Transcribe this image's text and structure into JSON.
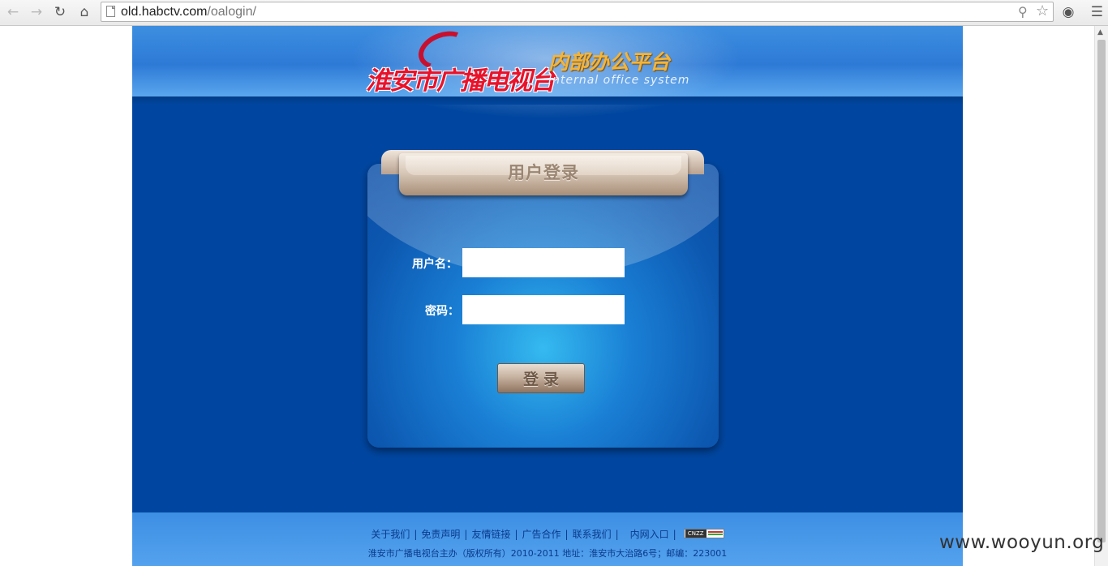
{
  "browser": {
    "url_host": "old.habctv.com",
    "url_path": "/oalogin/"
  },
  "site": {
    "logo_name": "淮安市广播电视台",
    "logo_subtitle": "内部办公平台",
    "logo_english": "Internal office system"
  },
  "login": {
    "title": "用户登录",
    "username_label": "用户名：",
    "username_value": "",
    "password_label": "密码：",
    "password_value": "",
    "submit_label": "登录"
  },
  "footer": {
    "links": [
      "关于我们",
      "免责声明",
      "友情链接",
      "广告合作",
      "联系我们",
      "内网入口"
    ],
    "badge_text": "CNZZ",
    "copyright": "淮安市广播电视台主办（版权所有）2010-2011  地址：淮安市大治路6号；邮编：223001"
  },
  "watermark": "www.wooyun.org",
  "colors": {
    "page_bg": "#0046a0",
    "banner": "#2d7ad6",
    "logo_red": "#e8132b",
    "logo_gold": "#f3b43a",
    "footer_text": "#0b3a8c"
  }
}
